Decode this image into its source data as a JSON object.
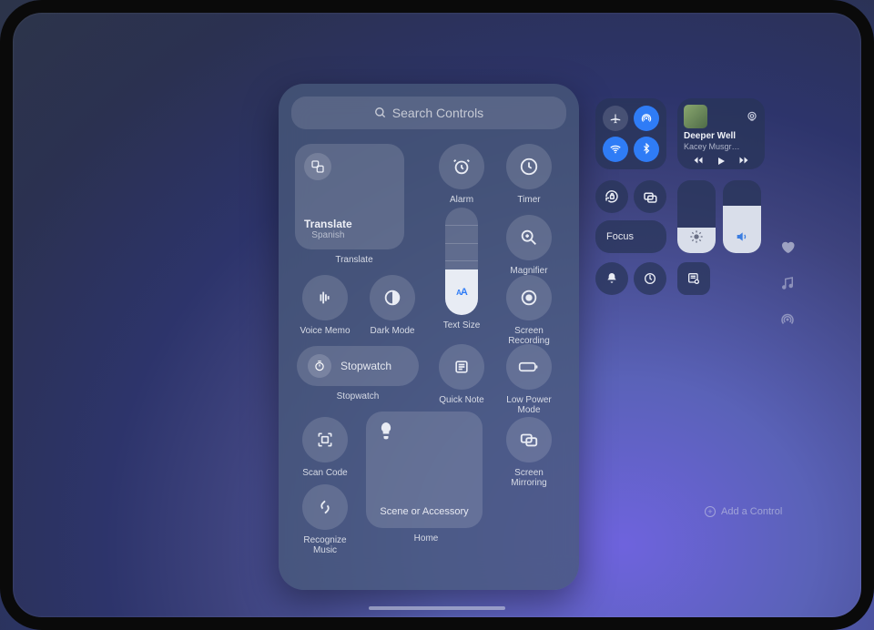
{
  "search": {
    "placeholder": "Search Controls"
  },
  "palette": {
    "translate": {
      "title": "Translate",
      "subtitle": "Spanish",
      "caption": "Translate"
    },
    "alarm": "Alarm",
    "timer": "Timer",
    "magnifier": "Magnifier",
    "voice_memo": "Voice Memo",
    "dark_mode": "Dark Mode",
    "text_size": "Text Size",
    "screen_recording": "Screen\nRecording",
    "stopwatch_label": "Stopwatch",
    "stopwatch_caption": "Stopwatch",
    "quick_note": "Quick Note",
    "low_power": "Low Power\nMode",
    "scan_code": "Scan Code",
    "recognize_music": "Recognize\nMusic",
    "home_tile": "Scene or Accessory",
    "home_caption": "Home",
    "screen_mirroring": "Screen\nMirroring"
  },
  "cc": {
    "focus": "Focus",
    "media": {
      "title": "Deeper Well",
      "artist": "Kacey Musgr…"
    },
    "brightness_pct": 35,
    "volume_pct": 65,
    "add_control": "Add a Control"
  }
}
